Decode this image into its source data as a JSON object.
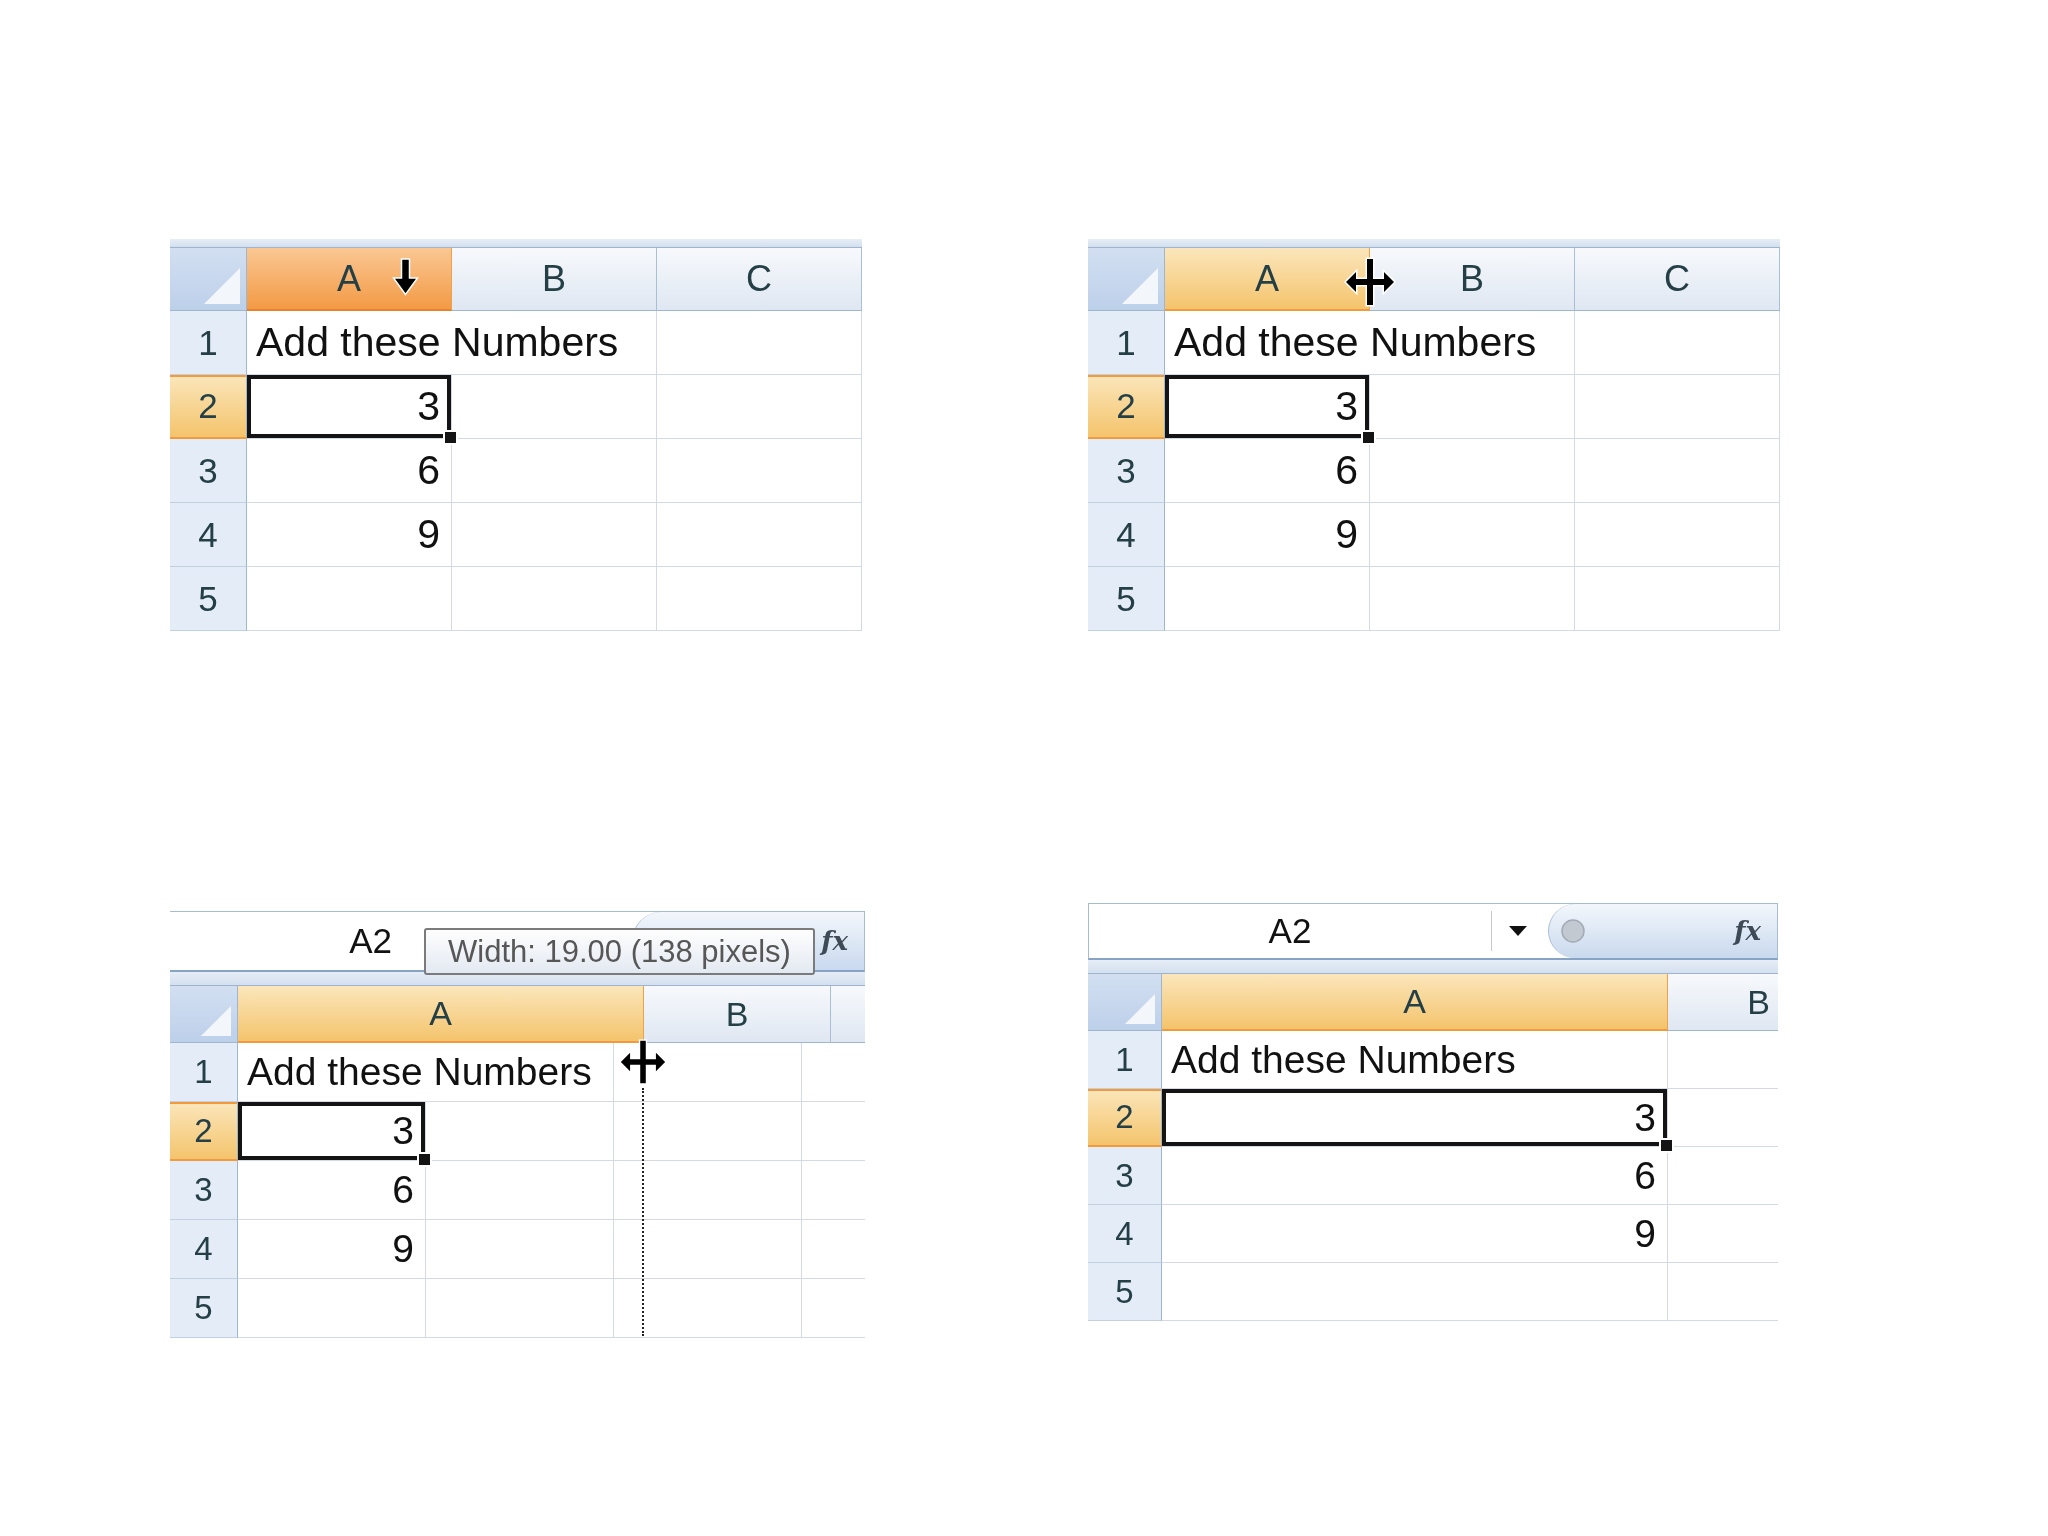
{
  "panels": [
    {
      "kind": "plain",
      "cursor": {
        "kind": "select-column"
      },
      "columns": [
        {
          "label": "A",
          "selected": true,
          "hovered": true
        },
        {
          "label": "B",
          "selected": false,
          "hovered": false
        },
        {
          "label": "C",
          "selected": false,
          "hovered": false
        }
      ],
      "rows": [
        {
          "label": "1",
          "selected": false,
          "cell": {
            "kind": "text",
            "value": "Add these Numbers",
            "active": false
          }
        },
        {
          "label": "2",
          "selected": true,
          "cell": {
            "kind": "number",
            "value": "3",
            "active": true
          }
        },
        {
          "label": "3",
          "selected": false,
          "cell": {
            "kind": "number",
            "value": "6",
            "active": false
          }
        },
        {
          "label": "4",
          "selected": false,
          "cell": {
            "kind": "number",
            "value": "9",
            "active": false
          }
        },
        {
          "label": "5",
          "selected": false
        }
      ]
    },
    {
      "kind": "plain",
      "cursor": {
        "kind": "resize-column"
      },
      "columns": [
        {
          "label": "A",
          "selected": true,
          "hovered": false
        },
        {
          "label": "B",
          "selected": false,
          "hovered": false
        },
        {
          "label": "C",
          "selected": false,
          "hovered": false
        }
      ],
      "rows": [
        {
          "label": "1",
          "selected": false,
          "cell": {
            "kind": "text",
            "value": "Add these Numbers",
            "active": false
          }
        },
        {
          "label": "2",
          "selected": true,
          "cell": {
            "kind": "number",
            "value": "3",
            "active": true
          }
        },
        {
          "label": "3",
          "selected": false,
          "cell": {
            "kind": "number",
            "value": "6",
            "active": false
          }
        },
        {
          "label": "4",
          "selected": false,
          "cell": {
            "kind": "number",
            "value": "9",
            "active": false
          }
        },
        {
          "label": "5",
          "selected": false
        }
      ]
    },
    {
      "kind": "resizing",
      "formula_bar": {
        "name_box": "A2",
        "function_button": "fx"
      },
      "tooltip": "Width: 19.00 (138 pixels)",
      "cursor": {
        "kind": "resize-column"
      },
      "columns": [
        {
          "label": "A",
          "selected": true,
          "hovered": false
        },
        {
          "label": "B",
          "selected": false,
          "hovered": false
        }
      ],
      "rows": [
        {
          "label": "1",
          "selected": false,
          "cell": {
            "kind": "text",
            "value": "Add these Numbers",
            "active": false
          }
        },
        {
          "label": "2",
          "selected": true,
          "cell": {
            "kind": "number",
            "value": "3",
            "active": true
          }
        },
        {
          "label": "3",
          "selected": false,
          "cell": {
            "kind": "number",
            "value": "6",
            "active": false
          }
        },
        {
          "label": "4",
          "selected": false,
          "cell": {
            "kind": "number",
            "value": "9",
            "active": false
          }
        },
        {
          "label": "5",
          "selected": false
        }
      ]
    },
    {
      "kind": "resized",
      "formula_bar": {
        "name_box": "A2",
        "function_button": "fx"
      },
      "columns": [
        {
          "label": "A",
          "selected": true,
          "hovered": false
        },
        {
          "label": "B",
          "selected": false,
          "hovered": false
        }
      ],
      "rows": [
        {
          "label": "1",
          "selected": false,
          "cell": {
            "kind": "text",
            "value": "Add these Numbers",
            "active": false
          }
        },
        {
          "label": "2",
          "selected": true,
          "cell": {
            "kind": "number",
            "value": "3",
            "active": true
          }
        },
        {
          "label": "3",
          "selected": false,
          "cell": {
            "kind": "number",
            "value": "6",
            "active": false
          }
        },
        {
          "label": "4",
          "selected": false,
          "cell": {
            "kind": "number",
            "value": "9",
            "active": false
          }
        },
        {
          "label": "5",
          "selected": false
        }
      ]
    }
  ]
}
